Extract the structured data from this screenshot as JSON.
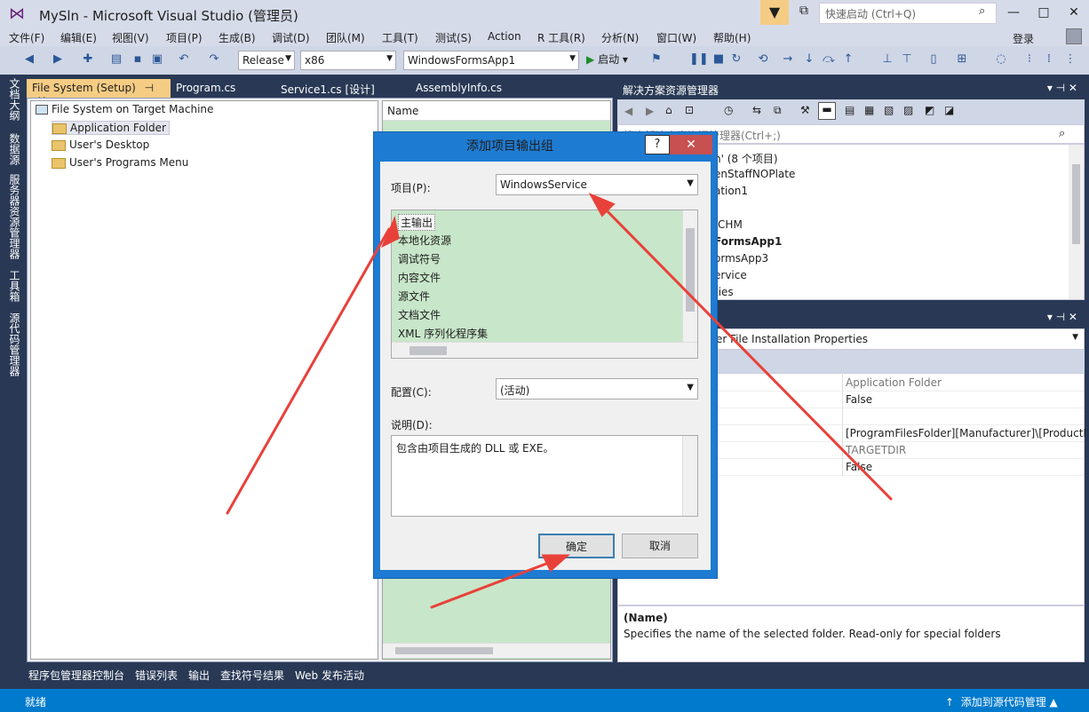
{
  "window": {
    "title": "MySln - Microsoft Visual Studio (管理员)",
    "quick_launch_placeholder": "快速启动 (Ctrl+Q)",
    "minimize_glyph": "—",
    "maximize_glyph": "□",
    "close_glyph": "✕"
  },
  "menu": [
    "文件(F)",
    "编辑(E)",
    "视图(V)",
    "项目(P)",
    "生成(B)",
    "调试(D)",
    "团队(M)",
    "工具(T)",
    "测试(S)",
    "Action",
    "R 工具(R)",
    "分析(N)",
    "窗口(W)",
    "帮助(H)"
  ],
  "account": {
    "login_label": "登录"
  },
  "toolbar": {
    "configuration": "Release",
    "platform": "x86",
    "startup_project": "WindowsFormsApp1",
    "start_label": "启动"
  },
  "left_tool_tabs": [
    "文档大纲",
    "数据源",
    "服务器资源管理器",
    "工具箱",
    "源代码管理器"
  ],
  "doc_tabs": {
    "active": "File System (Setup)",
    "others": [
      "Program.cs",
      "Service1.cs [设计]",
      "AssemblyInfo.cs"
    ]
  },
  "file_system": {
    "root": "File System on Target Machine",
    "folders": [
      "Application Folder",
      "User's Desktop",
      "User's Programs Menu"
    ],
    "list_header": "Name"
  },
  "solution_explorer": {
    "title": "解决方案资源管理器",
    "search_placeholder": "搜索解决方案资源管理器(Ctrl+;)",
    "items": [
      "n' (8 个项目)",
      "enStaffNOPlate",
      "ation1",
      "",
      ":CHM",
      "FormsApp1",
      "ormsApp3",
      "ervice",
      "ties"
    ]
  },
  "properties": {
    "object_label": "er File Installation Properties",
    "values": [
      "Application Folder",
      "False",
      "",
      "[ProgramFilesFolder][Manufacturer]\\[ProductName]",
      "TARGETDIR",
      "False"
    ],
    "desc_title": "(Name)",
    "desc_text": "Specifies the name of the selected folder. Read-only for special folders"
  },
  "bottom_tabs": [
    "程序包管理器控制台",
    "错误列表",
    "输出",
    "查找符号结果",
    "Web 发布活动"
  ],
  "status": {
    "left": "就绪",
    "right": "添加到源代码管理"
  },
  "dialog": {
    "title": "添加项目输出组",
    "help_glyph": "?",
    "close_glyph": "✕",
    "project_label": "项目(P):",
    "project_value": "WindowsService",
    "output_groups": [
      "主输出",
      "本地化资源",
      "调试符号",
      "内容文件",
      "源文件",
      "文档文件",
      "XML 序列化程序集"
    ],
    "config_label": "配置(C):",
    "config_value": "(活动)",
    "desc_label": "说明(D):",
    "desc_value": "包含由项目生成的 DLL 或 EXE。",
    "ok_label": "确定",
    "cancel_label": "取消"
  },
  "colors": {
    "accent_blue": "#007acc",
    "list_green": "#c8e6c9",
    "annotation_red": "#e8413a"
  }
}
